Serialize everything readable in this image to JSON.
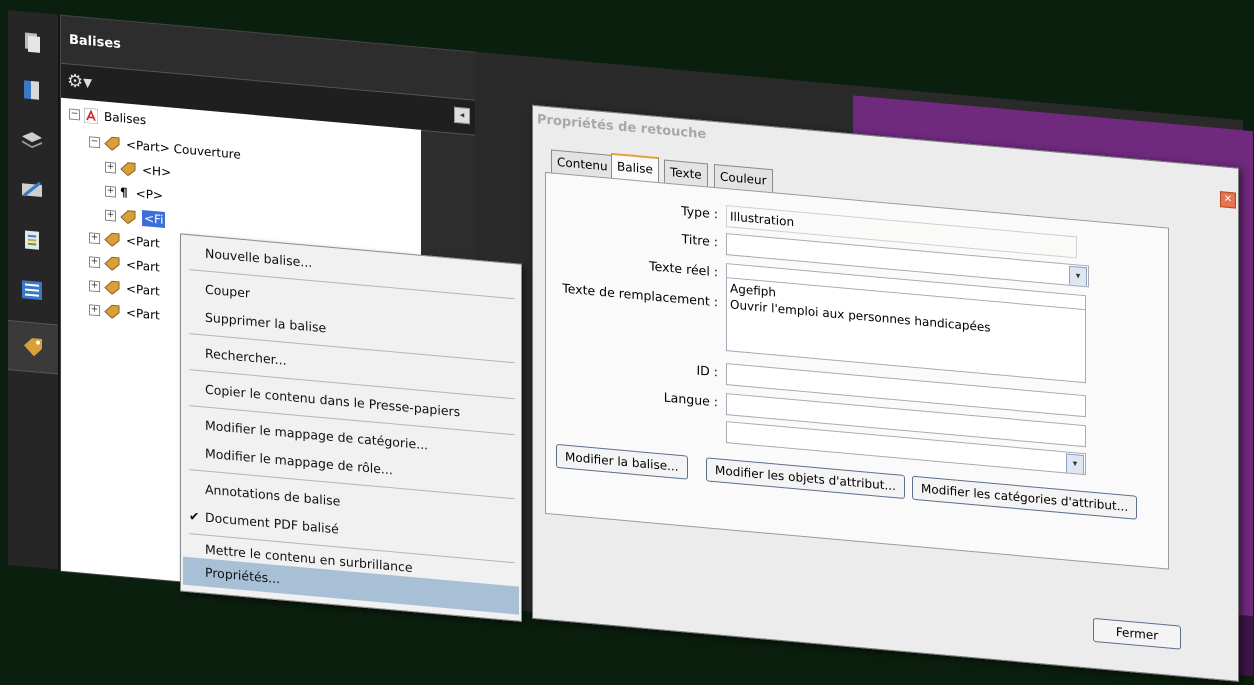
{
  "panel": {
    "title": "Balises",
    "collapse_glyph": "◂",
    "tree": {
      "root": "Balises",
      "items": [
        {
          "level": 1,
          "exp": "⊟",
          "label": "<Part> Couverture"
        },
        {
          "level": 2,
          "exp": "⊞",
          "label": "<H>"
        },
        {
          "level": 2,
          "exp": "⊞",
          "label": "<P>"
        },
        {
          "level": 2,
          "exp": "⊞",
          "label": "<Fi"
        },
        {
          "level": 1,
          "exp": "⊞",
          "label": "<Part"
        },
        {
          "level": 1,
          "exp": "⊞",
          "label": "<Part"
        },
        {
          "level": 1,
          "exp": "⊞",
          "label": "<Part"
        },
        {
          "level": 1,
          "exp": "⊞",
          "label": "<Part"
        }
      ]
    }
  },
  "nav_icons": [
    "pages-icon",
    "bookmarks-icon",
    "layers-icon",
    "signatures-icon",
    "content-icon",
    "order-icon",
    "tags-icon"
  ],
  "context_menu": {
    "items": [
      "Nouvelle balise...",
      "Couper",
      "Supprimer la balise",
      "Rechercher...",
      "Copier le contenu dans le Presse-papiers",
      "Modifier le mappage de catégorie...",
      "Modifier le mappage de rôle...",
      "Annotations de balise",
      "Document PDF balisé",
      "Mettre le contenu en surbrillance",
      "Propriétés..."
    ],
    "checked_glyph": "✔"
  },
  "dialog": {
    "title": "Propriétés de retouche",
    "close_glyph": "✕",
    "tabs": [
      "Contenu",
      "Balise",
      "Texte",
      "Couleur"
    ],
    "active_tab": "Balise",
    "fields": {
      "type_label": "Type :",
      "type_value": "Illustration",
      "titre_label": "Titre :",
      "titre_value": "",
      "texte_reel_label": "Texte réel :",
      "texte_reel_value": "",
      "alt_label": "Texte de remplacement :",
      "alt_value": "Agefiph\nOuvrir l'emploi aux personnes handicapées",
      "id_label": "ID :",
      "id_value": "",
      "langue_label": "Langue :",
      "langue_value": ""
    },
    "dropdown_glyph": "▾",
    "buttons": {
      "modifier_balise": "Modifier la balise...",
      "modifier_objets": "Modifier les objets d'attribut...",
      "modifier_categories": "Modifier les catégories d'attribut...",
      "fermer": "Fermer"
    }
  }
}
